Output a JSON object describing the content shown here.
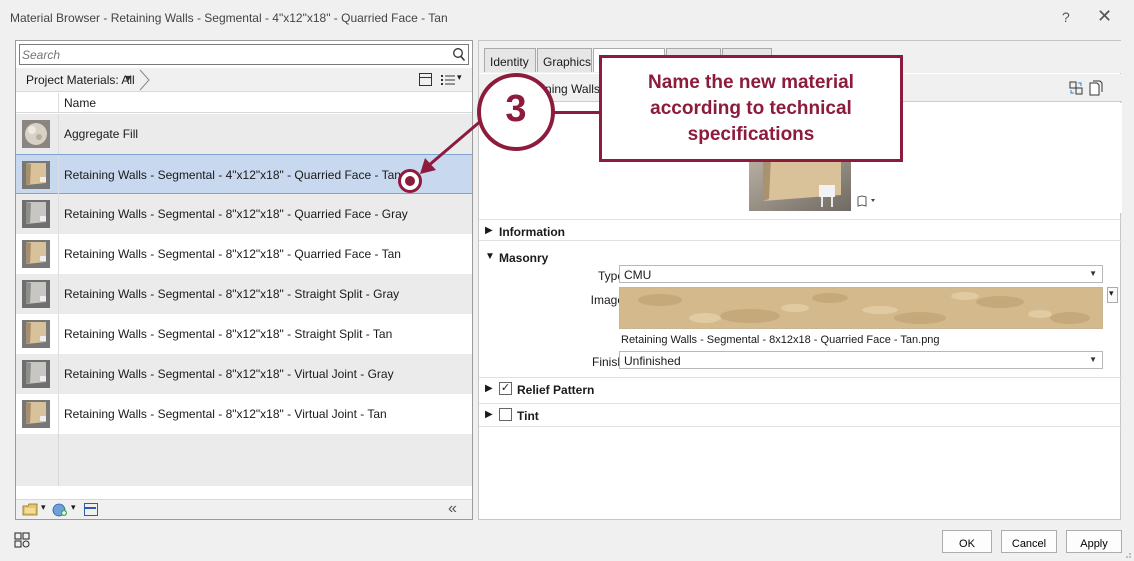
{
  "window": {
    "title": "Material Browser - Retaining Walls - Segmental - 4\"x12\"x18\" - Quarried Face - Tan",
    "help_glyph": "?",
    "close_glyph": "✕"
  },
  "browser": {
    "search_placeholder": "Search",
    "filter_label": "Project Materials: All",
    "column_name": "Name",
    "materials": [
      {
        "label": "Aggregate Fill",
        "thumb": "aggregate-sphere",
        "selected": false
      },
      {
        "label": "Retaining Walls - Segmental - 4\"x12\"x18\" - Quarried Face - Tan",
        "thumb": "wall-tan",
        "selected": true
      },
      {
        "label": "Retaining Walls - Segmental - 8\"x12\"x18\" -  Quarried Face - Gray",
        "thumb": "wall-gray",
        "selected": false
      },
      {
        "label": "Retaining Walls - Segmental - 8\"x12\"x18\" - Quarried Face - Tan",
        "thumb": "wall-tan",
        "selected": false
      },
      {
        "label": "Retaining Walls - Segmental - 8\"x12\"x18\" - Straight Split - Gray",
        "thumb": "wall-gray",
        "selected": false
      },
      {
        "label": "Retaining Walls - Segmental - 8\"x12\"x18\" - Straight Split - Tan",
        "thumb": "wall-tan",
        "selected": false
      },
      {
        "label": "Retaining Walls - Segmental - 8\"x12\"x18\" - Virtual Joint - Gray",
        "thumb": "wall-gray",
        "selected": false
      },
      {
        "label": "Retaining Walls - Segmental - 8\"x12\"x18\" - Virtual Joint - Tan",
        "thumb": "wall-tan",
        "selected": false
      }
    ],
    "collapse_glyph": "«"
  },
  "editor": {
    "tabs": [
      "Identity",
      "Graphics",
      "Appearance",
      "Physical",
      "Thermal"
    ],
    "asset_name": "Retaining Walls - Segmental - 8x12x18 - Quarried Face - Tan",
    "sections": {
      "information": "Information",
      "masonry": "Masonry",
      "relief_pattern": "Relief Pattern",
      "tint": "Tint"
    },
    "relief_checked": true,
    "tint_checked": false,
    "type_label": "Type",
    "type_value": "CMU",
    "image_label": "Image",
    "image_file": "Retaining Walls - Segmental - 8x12x18 - Quarried Face - Tan.png",
    "finish_label": "Finish",
    "finish_value": "Unfinished"
  },
  "footer": {
    "ok": "OK",
    "cancel": "Cancel",
    "apply": "Apply"
  },
  "annotation": {
    "step_number": "3",
    "text": "Name the new material according to technical specifications",
    "color": "#8c1b3c"
  },
  "colors": {
    "selection": "#c8d8ee",
    "accent": "#8c1b3c",
    "swatch": "#d4b98c"
  }
}
